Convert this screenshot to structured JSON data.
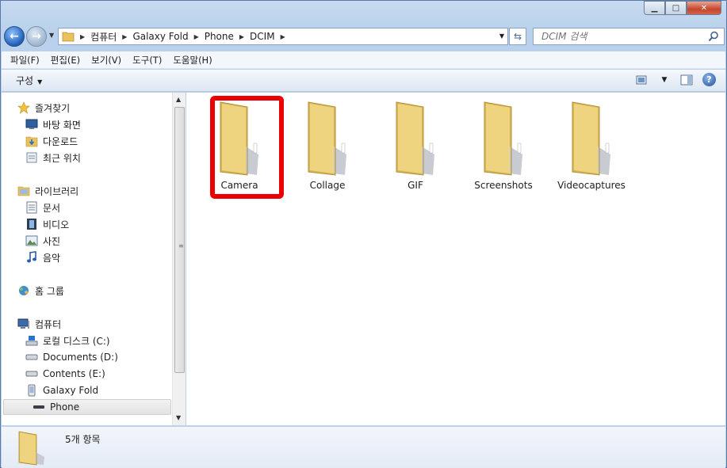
{
  "navigation": {
    "breadcrumbs": [
      "컴퓨터",
      "Galaxy Fold",
      "Phone",
      "DCIM"
    ]
  },
  "search": {
    "placeholder": "DCIM 검색"
  },
  "menubar": [
    "파일(F)",
    "편집(E)",
    "보기(V)",
    "도구(T)",
    "도움말(H)"
  ],
  "toolbar": {
    "organize_label": "구성"
  },
  "sidebar": {
    "favorites": {
      "label": "즐겨찾기",
      "items": [
        "바탕 화면",
        "다운로드",
        "최근 위치"
      ]
    },
    "libraries": {
      "label": "라이브러리",
      "items": [
        "문서",
        "비디오",
        "사진",
        "음악"
      ]
    },
    "homegroup": {
      "label": "홈 그룹"
    },
    "computer": {
      "label": "컴퓨터",
      "items": [
        "로컬 디스크 (C:)",
        "Documents (D:)",
        "Contents (E:)",
        "Galaxy Fold",
        "Phone"
      ]
    }
  },
  "folders": [
    {
      "name": "Camera",
      "highlighted": true
    },
    {
      "name": "Collage"
    },
    {
      "name": "GIF"
    },
    {
      "name": "Screenshots"
    },
    {
      "name": "Videocaptures"
    }
  ],
  "details": {
    "count": "5개 항목"
  },
  "colors": {
    "highlight": "#ec0000",
    "folder": "#f2d27a"
  }
}
